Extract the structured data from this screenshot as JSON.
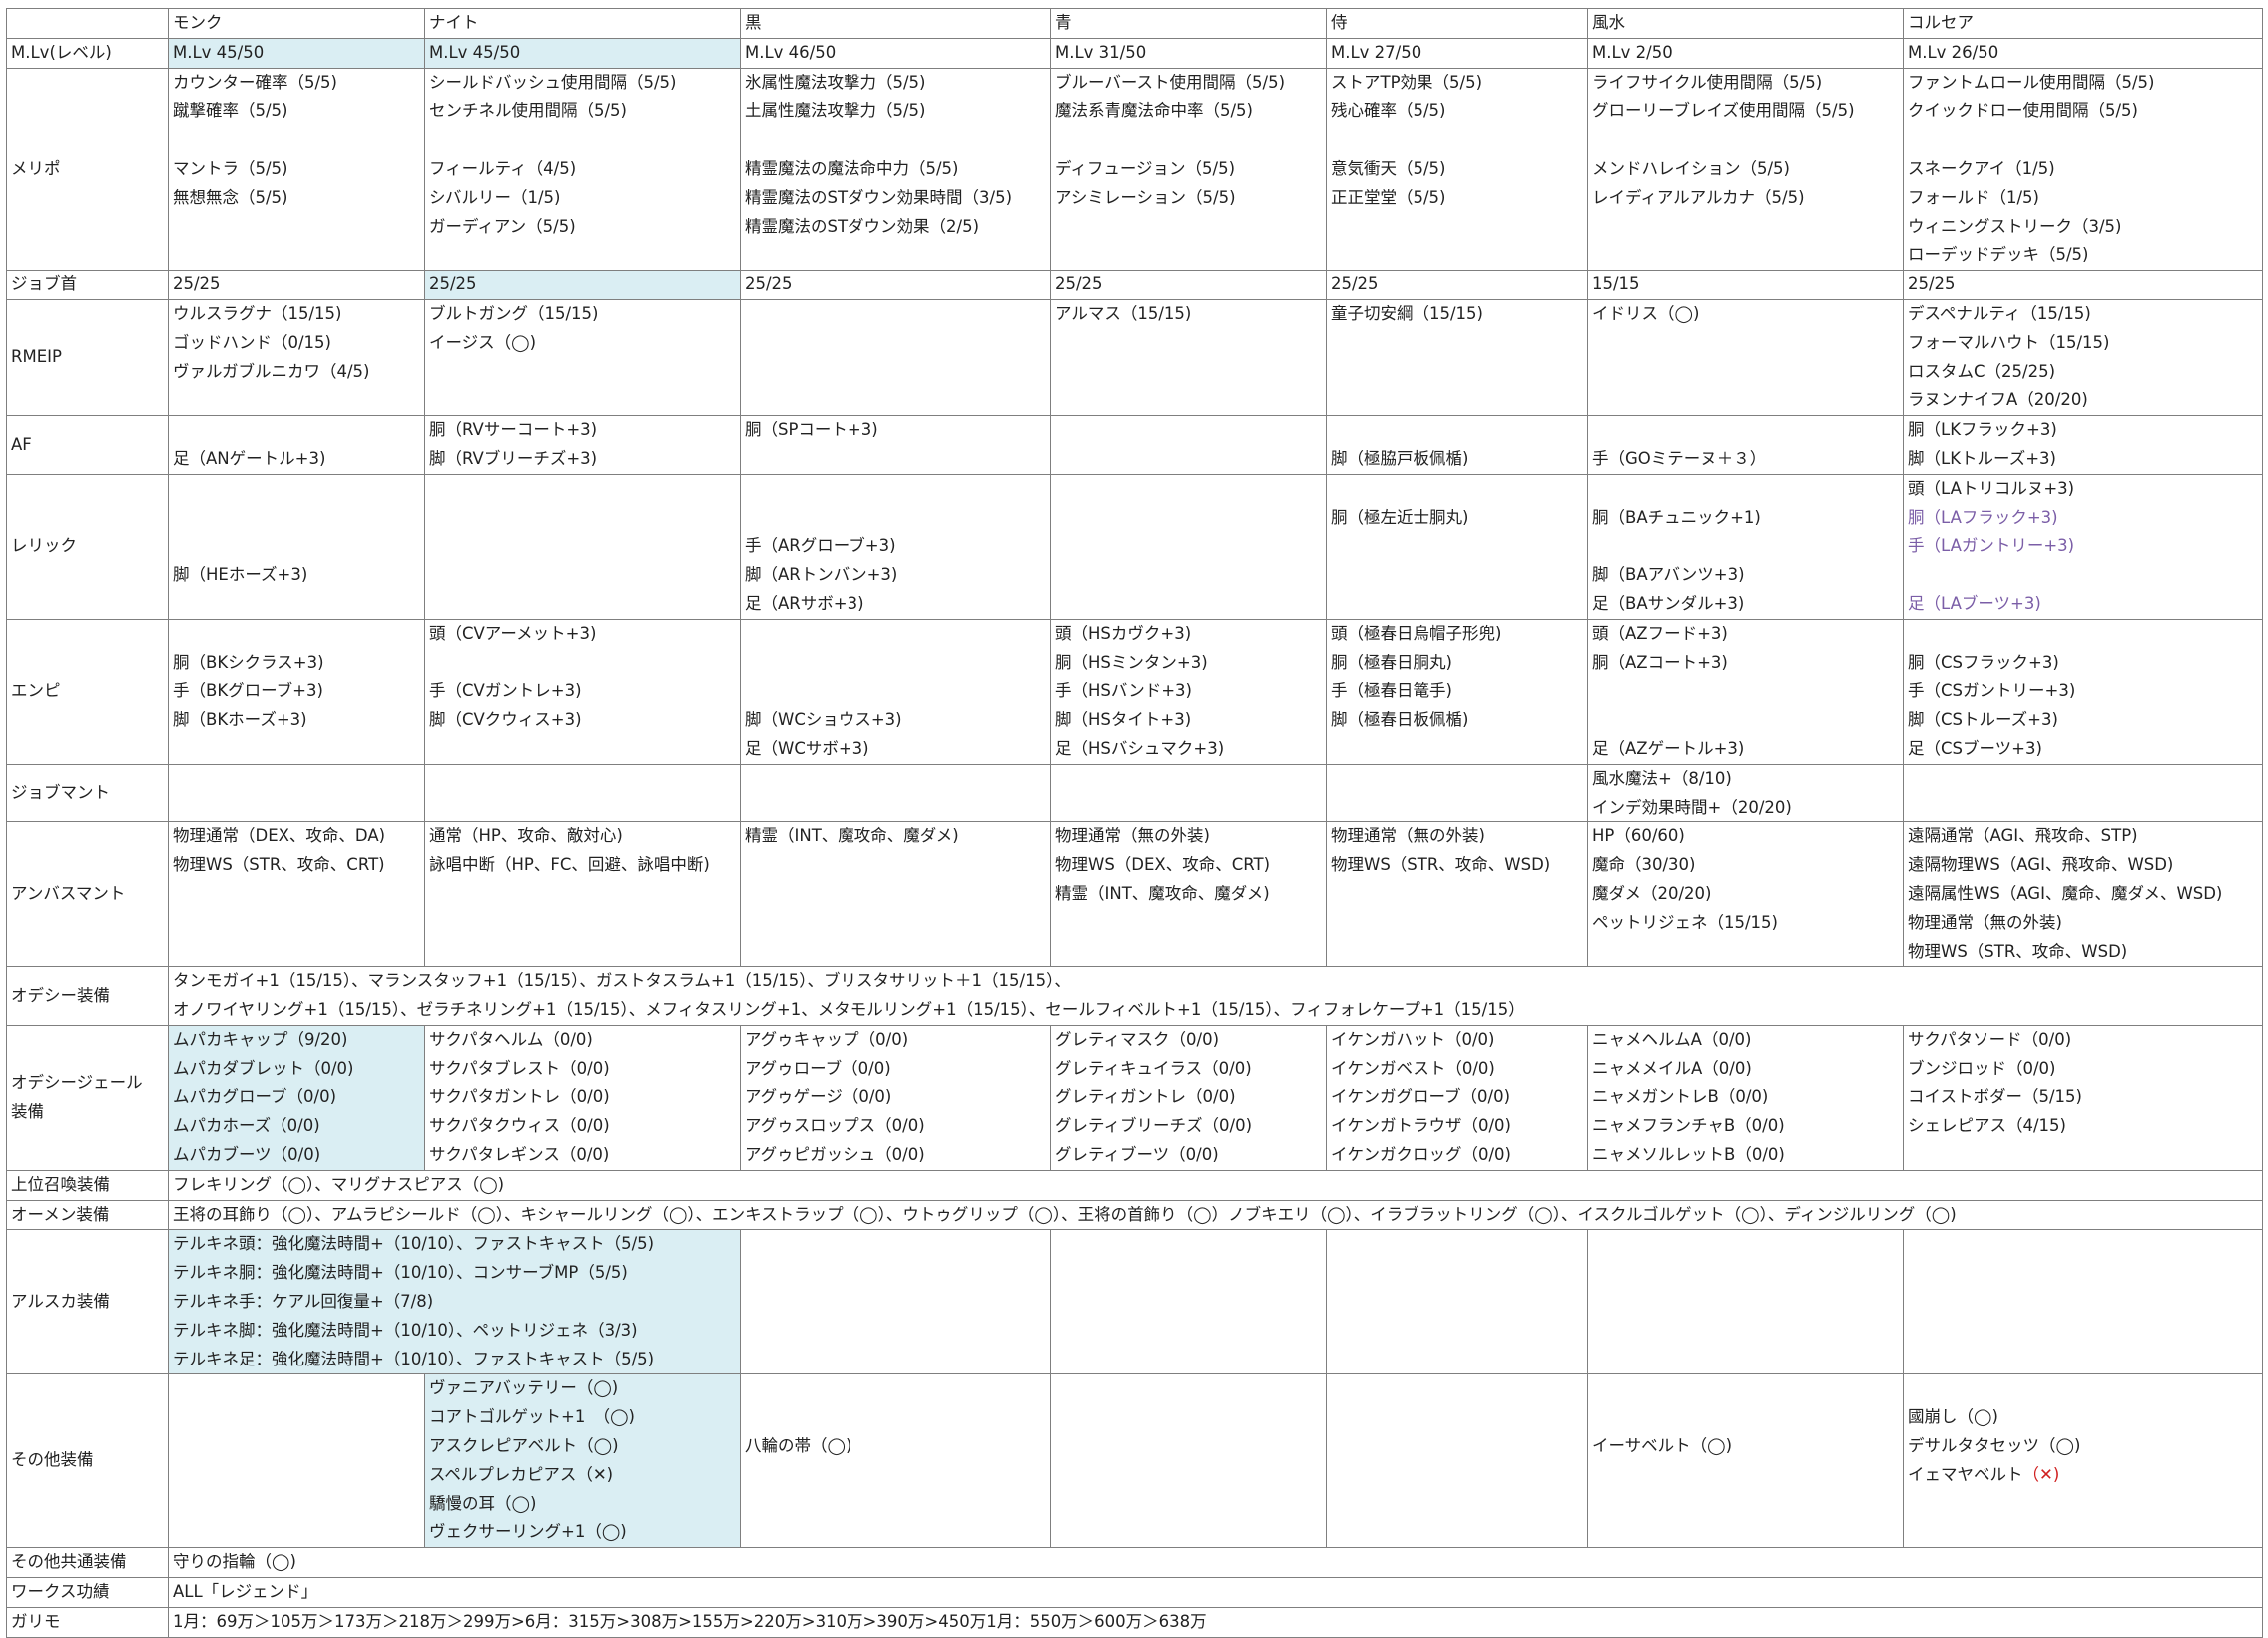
{
  "columns": [
    "",
    "モンク",
    "ナイト",
    "黒",
    "青",
    "侍",
    "風水",
    "コルセア"
  ],
  "rows": [
    {
      "label": "M.Lv(レベル)",
      "lines": 1,
      "cells": [
        [
          "M.Lv 45/50"
        ],
        [
          "M.Lv 45/50"
        ],
        [
          "M.Lv 46/50"
        ],
        [
          "M.Lv 31/50"
        ],
        [
          "M.Lv 27/50"
        ],
        [
          "M.Lv 2/50"
        ],
        [
          "M.Lv 26/50"
        ]
      ]
    },
    {
      "label": "メリポ",
      "lines": 7,
      "cells": [
        [
          "カウンター確率（5/5)",
          "蹴撃確率（5/5)",
          "",
          "マントラ（5/5)",
          "無想無念（5/5)"
        ],
        [
          "シールドバッシュ使用間隔（5/5)",
          "センチネル使用間隔（5/5)",
          "",
          "フィールティ（4/5)",
          "シバルリー（1/5)",
          "ガーディアン（5/5)"
        ],
        [
          "氷属性魔法攻撃力（5/5)",
          "土属性魔法攻撃力（5/5)",
          "",
          "精霊魔法の魔法命中力（5/5)",
          "精霊魔法のSTダウン効果時間（3/5)",
          "精霊魔法のSTダウン効果（2/5)"
        ],
        [
          "ブルーバースト使用間隔（5/5)",
          "魔法系青魔法命中率（5/5)",
          "",
          "ディフュージョン（5/5)",
          "アシミレーション（5/5)"
        ],
        [
          "ストアTP効果（5/5)",
          "残心確率（5/5)",
          "",
          "意気衝天（5/5)",
          "正正堂堂（5/5)"
        ],
        [
          "ライフサイクル使用間隔（5/5)",
          "グローリーブレイズ使用間隔（5/5)",
          "",
          "メンドハレイション（5/5)",
          "レイディアルアルカナ（5/5)"
        ],
        [
          "ファントムロール使用間隔（5/5)",
          "クイックドロー使用間隔（5/5)",
          "",
          "スネークアイ（1/5)",
          "フォールド（1/5)",
          "ウィニングストリーク（3/5)",
          "ローデッドデッキ（5/5)"
        ]
      ]
    },
    {
      "label": "ジョブ首",
      "lines": 1,
      "cells": [
        [
          "25/25"
        ],
        [
          "25/25"
        ],
        [
          "25/25"
        ],
        [
          "25/25"
        ],
        [
          "25/25"
        ],
        [
          "15/15"
        ],
        [
          "25/25"
        ]
      ]
    },
    {
      "label": "RMEIP",
      "lines": 4,
      "cells": [
        [
          "ウルスラグナ（15/15)",
          "ゴッドハンド（0/15)",
          "ヴァルガブルニカワ（4/5)"
        ],
        [
          "ブルトガング（15/15)",
          "イージス（◯)"
        ],
        [],
        [
          "アルマス（15/15)"
        ],
        [
          "童子切安綱（15/15)"
        ],
        [
          "イドリス（◯)"
        ],
        [
          "デスペナルティ（15/15)",
          "フォーマルハウト（15/15)",
          "ロスタムC（25/25)",
          "ラヌンナイフA（20/20)"
        ]
      ]
    },
    {
      "label": "AF",
      "lines": 2,
      "cells": [
        [
          "",
          "足（ANゲートル+3)"
        ],
        [
          "胴（RVサーコート+3)",
          "脚（RVブリーチズ+3)"
        ],
        [
          "胴（SPコート+3)"
        ],
        [],
        [
          "",
          "脚（極脇戸板佩楯)"
        ],
        [
          "",
          "手（GOミテーヌ＋３）"
        ],
        [
          "胴（LKフラック+3)",
          "脚（LKトルーズ+3)"
        ]
      ]
    },
    {
      "label": "レリック",
      "lines": 5,
      "cells": [
        [
          "",
          "",
          "",
          "脚（HEホーズ+3)"
        ],
        [],
        [
          "",
          "",
          "手（ARグローブ+3)",
          "脚（ARトンバン+3)",
          "足（ARサボ+3)"
        ],
        [],
        [
          "",
          "胴（極左近士胴丸)"
        ],
        [
          "",
          "胴（BAチュニック+1)",
          "",
          "脚（BAアバンツ+3)",
          "足（BAサンダル+3)"
        ],
        [
          "頭（LAトリコルヌ+3)",
          "胴（LAフラック+3)",
          "手（LAガントリー+3)",
          "",
          "足（LAブーツ+3)"
        ]
      ]
    },
    {
      "label": "エンピ",
      "lines": 5,
      "cells": [
        [
          "",
          "胴（BKシクラス+3)",
          "手（BKグローブ+3)",
          "脚（BKホーズ+3)"
        ],
        [
          "頭（CVアーメット+3)",
          "",
          "手（CVガントレ+3)",
          "脚（CVクウィス+3)"
        ],
        [
          "",
          "",
          "",
          "脚（WCショウス+3)",
          "足（WCサボ+3)"
        ],
        [
          "頭（HSカヴク+3)",
          "胴（HSミンタン+3)",
          "手（HSバンド+3)",
          "脚（HSタイト+3)",
          "足（HSバシュマク+3)"
        ],
        [
          "頭（極春日烏帽子形兜)",
          "胴（極春日胴丸)",
          "手（極春日篭手)",
          "脚（極春日板佩楯)"
        ],
        [
          "頭（AZフード+3)",
          "胴（AZコート+3)",
          "",
          "",
          "足（AZゲートル+3)"
        ],
        [
          "",
          "胴（CSフラック+3)",
          "手（CSガントリー+3)",
          "脚（CSトルーズ+3)",
          "足（CSブーツ+3)"
        ]
      ]
    },
    {
      "label": "ジョブマント",
      "lines": 2,
      "cells": [
        [],
        [],
        [],
        [],
        [],
        [
          "風水魔法+（8/10)",
          "インデ効果時間+（20/20)"
        ],
        []
      ]
    },
    {
      "label": "アンバスマント",
      "lines": 5,
      "cells": [
        [
          "物理通常（DEX、攻命、DA)",
          "物理WS（STR、攻命、CRT)"
        ],
        [
          "通常（HP、攻命、敵対心)",
          "詠唱中断（HP、FC、回避、詠唱中断)"
        ],
        [
          "精霊（INT、魔攻命、魔ダメ)"
        ],
        [
          "物理通常（無の外装)",
          "物理WS（DEX、攻命、CRT)",
          "精霊（INT、魔攻命、魔ダメ)"
        ],
        [
          "物理通常（無の外装)",
          "物理WS（STR、攻命、WSD)"
        ],
        [
          "HP（60/60)",
          "魔命（30/30)",
          "魔ダメ（20/20)",
          "ペットリジェネ（15/15)"
        ],
        [
          "遠隔通常（AGI、飛攻命、STP)",
          "遠隔物理WS（AGI、飛攻命、WSD)",
          "遠隔属性WS（AGI、魔命、魔ダメ、WSD)",
          "物理通常（無の外装)",
          "物理WS（STR、攻命、WSD)"
        ]
      ]
    },
    {
      "label": "オデシー装備",
      "lines": 2,
      "span": [
        "タンモガイ+1（15/15）、マランスタッフ+1（15/15）、ガストタスラム+1（15/15）、ブリスタサリット＋1（15/15）、",
        "オノワイヤリング+1（15/15）、ゼラチネリング+1（15/15）、メフィタスリング+1、メタモルリング+1（15/15）、セールフィベルト+1（15/15）、フィフォレケープ+1（15/15）"
      ]
    },
    {
      "label": "オデシージェール装備",
      "label2": [
        "オデシージェール",
        "装備"
      ],
      "lines": 5,
      "cells": [
        [
          "ムパカキャップ（9/20)",
          "ムパカダブレット（0/0)",
          "ムパカグローブ（0/0)",
          "ムパカホーズ（0/0)",
          "ムパカブーツ（0/0)"
        ],
        [
          "サクパタヘルム（0/0)",
          "サクパタブレスト（0/0)",
          "サクパタガントレ（0/0)",
          "サクパタクウィス（0/0)",
          "サクパタレギンス（0/0)"
        ],
        [
          "アグゥキャップ（0/0)",
          "アグゥローブ（0/0)",
          "アグゥゲージ（0/0)",
          "アグゥスロップス（0/0)",
          "アグゥピガッシュ（0/0)"
        ],
        [
          "グレティマスク（0/0)",
          "グレティキュイラス（0/0)",
          "グレティガントレ（0/0)",
          "グレティブリーチズ（0/0)",
          "グレティブーツ（0/0)"
        ],
        [
          "イケンガハット（0/0)",
          "イケンガベスト（0/0)",
          "イケンガグローブ（0/0)",
          "イケンガトラウザ（0/0)",
          "イケンガクロッグ（0/0)"
        ],
        [
          "ニャメヘルムA（0/0)",
          "ニャメメイルA（0/0)",
          "ニャメガントレB（0/0)",
          "ニャメフランチャB（0/0)",
          "ニャメソルレットB（0/0)"
        ],
        [
          "サクパタソード（0/0)",
          "ブンジロッド（0/0)",
          "コイストボダー（5/15)",
          "シェレピアス（4/15)"
        ]
      ]
    },
    {
      "label": "上位召喚装備",
      "lines": 1,
      "span": [
        "フレキリング（◯）、マリグナスピアス（◯)"
      ]
    },
    {
      "label": "オーメン装備",
      "lines": 1,
      "span": [
        "王将の耳飾り（◯）、アムラピシールド（◯）、キシャールリング（◯）、エンキストラップ（◯）、ウトゥグリップ（◯）、王将の首飾り（◯）ノブキエリ（◯）、イラブラットリング（◯）、イスクルゴルゲット（◯）、ディンジルリング（◯)"
      ]
    },
    {
      "label": "アルスカ装備",
      "lines": 5,
      "alska": [
        "テルキネ頭：強化魔法時間+（10/10）、ファストキャスト（5/5)",
        "テルキネ胴：強化魔法時間+（10/10）、コンサーブMP（5/5)",
        "テルキネ手：ケアル回復量+（7/8)",
        "テルキネ脚：強化魔法時間+（10/10）、ペットリジェネ（3/3)",
        "テルキネ足：強化魔法時間+（10/10）、ファストキャスト（5/5)"
      ]
    },
    {
      "label": "その他装備",
      "lines": 6,
      "cells": [
        [],
        [
          "ヴァニアバッテリー（◯)",
          "コアトゴルゲット+1　（◯)",
          "アスクレピアベルト（◯)",
          "スペルプレカピアス（✕)",
          "驕慢の耳（◯)",
          "ヴェクサーリング+1（◯)"
        ],
        [
          "",
          "",
          "八輪の帯（◯)"
        ],
        [],
        [],
        [
          "",
          "",
          "イーサベルト（◯)"
        ],
        [
          "",
          "國崩し（◯)",
          "デサルタタセッツ（◯)",
          "イェマヤベルト（✕)"
        ]
      ]
    },
    {
      "label": "その他共通装備",
      "lines": 1,
      "span": [
        "守りの指輪（◯)"
      ]
    },
    {
      "label": "ワークス功績",
      "lines": 1,
      "span": [
        "ALL「レジェンド」"
      ]
    },
    {
      "label": "ガリモ",
      "lines": 1,
      "span": [
        "1月：69万＞105万＞173万＞218万＞299万>6月：315万>308万>155万>220万>310万>390万>450万1月：550万＞600万＞638万"
      ]
    }
  ],
  "highlight_color": "#daeef3",
  "purple_color": "#7b5ea7",
  "red_color": "#d02020"
}
